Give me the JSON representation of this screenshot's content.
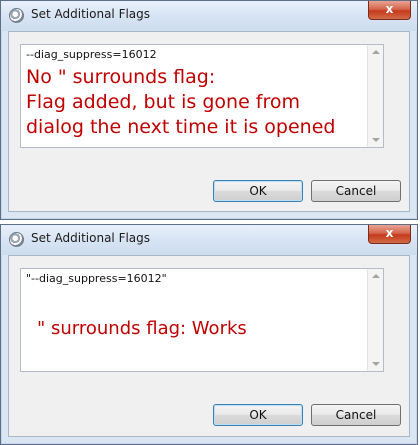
{
  "dialogs": [
    {
      "title": "Set Additional Flags",
      "close_label": "x",
      "flag_value": "--diag_suppress=16012",
      "annotation_lines": [
        "No \" surrounds flag:",
        "Flag added, but is gone from",
        "dialog the next time it is opened"
      ],
      "ok_label": "OK",
      "cancel_label": "Cancel"
    },
    {
      "title": "Set Additional Flags",
      "close_label": "x",
      "flag_value": "\"--diag_suppress=16012\"",
      "annotation_lines": [
        "\" surrounds flag: Works"
      ],
      "ok_label": "OK",
      "cancel_label": "Cancel"
    }
  ],
  "colors": {
    "annotation": "#c00000",
    "close_button": "#c43a1c",
    "window_frame": "#dbe6f3"
  },
  "icons": [
    "app-icon",
    "close-icon",
    "scroll-up-arrow-icon",
    "scroll-down-arrow-icon"
  ]
}
